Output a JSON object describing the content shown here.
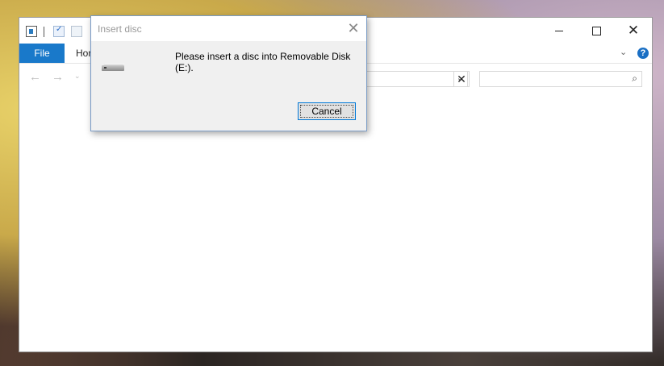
{
  "explorer": {
    "ribbon": {
      "file_tab": "File",
      "home_tab": "Hor"
    },
    "icons": {
      "explorer": "explorer-icon",
      "properties": "properties-icon",
      "new_folder": "new-folder-icon",
      "minimize": "minimize-icon",
      "maximize": "maximize-icon",
      "close": "close-icon",
      "help": "help-icon",
      "back": "back-arrow-icon",
      "forward": "forward-arrow-icon",
      "recent": "recent-locations-icon",
      "dropdown": "chevron-down-icon",
      "clear": "clear-icon",
      "search": "search-icon"
    },
    "help_glyph": "?",
    "address_value": "",
    "search_value": ""
  },
  "dialog": {
    "title": "Insert disc",
    "message": "Please insert a disc into Removable Disk (E:).",
    "cancel_label": "Cancel",
    "icon": "removable-drive-icon"
  },
  "colors": {
    "file_tab": "#1979ca",
    "help_icon": "#1a6fc4",
    "focus_border": "#0078d7"
  }
}
